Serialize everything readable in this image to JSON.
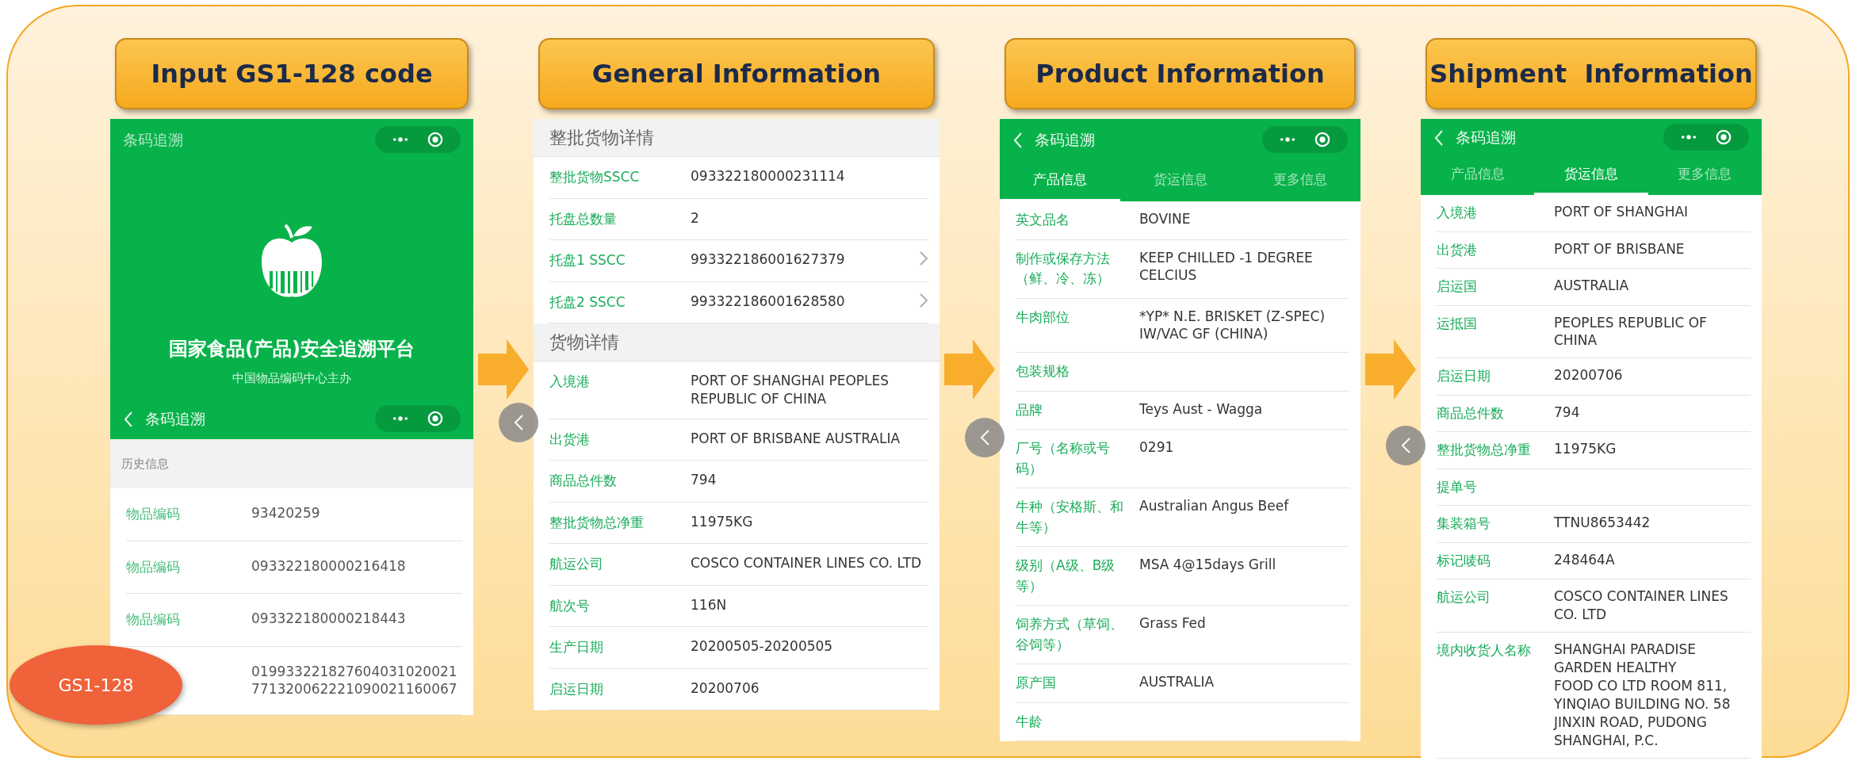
{
  "badge": "GS1-128",
  "steps": [
    {
      "heading": "Input GS1-128 code",
      "screen": {
        "carousel_button": false,
        "blocks": [
          {
            "kind": "navbar",
            "title": "条码追溯",
            "back": false
          },
          {
            "kind": "hero",
            "title": "国家食品(产品)安全追溯平台",
            "subtitle": "中国物品编码中心主办"
          },
          {
            "kind": "navbar",
            "title": "条码追溯",
            "back": true
          },
          {
            "kind": "subsection",
            "title": "历史信息"
          },
          {
            "kind": "rows",
            "rows": [
              {
                "label": "物品编码",
                "value": "93420259"
              },
              {
                "label": "物品编码",
                "value": "093322180000216418"
              },
              {
                "label": "物品编码",
                "value": "093322180000218443"
              },
              {
                "value": "019933221827604031020021771320062221090021160067"
              }
            ]
          }
        ]
      }
    },
    {
      "heading": "General Information",
      "screen": {
        "carousel_button": true,
        "blocks": [
          {
            "kind": "section",
            "title": "整批货物详情"
          },
          {
            "kind": "rows",
            "rows": [
              {
                "label": "整批货物SSCC",
                "value": "093322180000231114",
                "chevron": false
              },
              {
                "label": "托盘总数量",
                "value": "2",
                "chevron": false
              },
              {
                "label": "托盘1 SSCC",
                "value": "993322186001627379",
                "chevron": true
              },
              {
                "label": "托盘2 SSCC",
                "value": "993322186001628580",
                "chevron": true
              }
            ]
          },
          {
            "kind": "section",
            "title": "货物详情"
          },
          {
            "kind": "rows",
            "rows": [
              {
                "label": "入境港",
                "value": "PORT OF SHANGHAI PEOPLES REPUBLIC OF CHINA",
                "chevron": false
              },
              {
                "label": "出货港",
                "value": "PORT OF BRISBANE AUSTRALIA",
                "chevron": false
              },
              {
                "label": "商品总件数",
                "value": "794",
                "chevron": false
              },
              {
                "label": "整批货物总净重",
                "value": "11975KG",
                "chevron": false
              },
              {
                "label": "航运公司",
                "value": "COSCO CONTAINER LINES CO. LTD",
                "chevron": false
              },
              {
                "label": "航次号",
                "value": "116N",
                "chevron": false
              },
              {
                "label": "生产日期",
                "value": "20200505-20200505",
                "chevron": false
              },
              {
                "label": "启运日期",
                "value": "20200706",
                "chevron": false
              }
            ]
          }
        ]
      }
    },
    {
      "heading": "Product Information",
      "screen": {
        "carousel_button": true,
        "blocks": [
          {
            "kind": "navbar",
            "title": "条码追溯",
            "back": true
          },
          {
            "kind": "tabs",
            "tabs": [
              {
                "label": "产品信息",
                "selected": true
              },
              {
                "label": "货运信息",
                "selected": false
              },
              {
                "label": "更多信息",
                "selected": false
              }
            ]
          },
          {
            "kind": "rows",
            "rows": [
              {
                "label": "英文品名",
                "value": "BOVINE"
              },
              {
                "label": "制作或保存方法（鲜、冷、冻）",
                "value": "KEEP CHILLED -1 DEGREE CELCIUS"
              },
              {
                "label": "牛肉部位",
                "value": "*YP* N.E. BRISKET (Z-SPEC) IW/VAC GF (CHINA)"
              },
              {
                "label": "包装规格"
              },
              {
                "label": "品牌",
                "value": "Teys Aust - Wagga"
              },
              {
                "label": "厂号（名称或号码）",
                "value": "0291"
              },
              {
                "label": "牛种（安格斯、和牛等）",
                "value": "Australian Angus Beef"
              },
              {
                "label": "级别（A级、B级等）",
                "value": "MSA 4@15days Grill"
              },
              {
                "label": "饲养方式（草饲、谷饲等）",
                "value": "Grass Fed"
              },
              {
                "label": "原产国",
                "value": "AUSTRALIA"
              },
              {
                "label": "牛龄"
              }
            ]
          }
        ]
      }
    },
    {
      "heading": "Shipment  Information",
      "screen": {
        "carousel_button": true,
        "blocks": [
          {
            "kind": "navbar",
            "title": "条码追溯",
            "back": true
          },
          {
            "kind": "tabs",
            "tabs": [
              {
                "label": "产品信息",
                "selected": false
              },
              {
                "label": "货运信息",
                "selected": true
              },
              {
                "label": "更多信息",
                "selected": false
              }
            ]
          },
          {
            "kind": "rows",
            "rows": [
              {
                "label": "入境港",
                "value": "PORT OF SHANGHAI"
              },
              {
                "label": "出货港",
                "value": "PORT OF BRISBANE"
              },
              {
                "label": "启运国",
                "value": "AUSTRALIA"
              },
              {
                "label": "运抵国",
                "value": "PEOPLES REPUBLIC OF CHINA"
              },
              {
                "label": "启运日期",
                "value": "20200706"
              },
              {
                "label": "商品总件数",
                "value": "794"
              },
              {
                "label": "整批货物总净重",
                "value": "11975KG"
              },
              {
                "label": "提单号"
              },
              {
                "label": "集装箱号",
                "value": "TTNU8653442"
              },
              {
                "label": "标记唛码",
                "value": "248464A"
              },
              {
                "label": "航运公司",
                "value": "COSCO CONTAINER LINES CO. LTD"
              },
              {
                "label": "境内收货人名称",
                "value": "SHANGHAI PARADISE GARDEN HEALTHY\nFOOD CO LTD ROOM 811, YINQIAO BUILDING NO. 58 JINXIN ROAD, PUDONG\nSHANGHAI, P.C."
              }
            ]
          }
        ]
      }
    }
  ]
}
